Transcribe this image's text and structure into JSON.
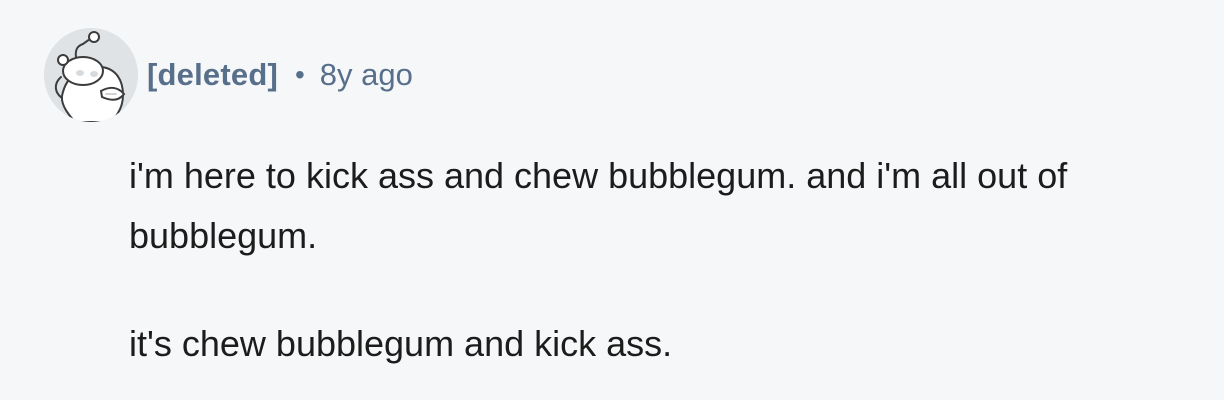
{
  "comment": {
    "avatar_icon": "deleted-user-snoo-icon",
    "author": "[deleted]",
    "separator": "•",
    "timestamp": "8y ago",
    "paragraphs": [
      "i'm here to kick ass and chew bubblegum. and i'm all out of bubblegum.",
      "it's chew bubblegum and kick ass."
    ]
  },
  "colors": {
    "background": "#f6f7f8",
    "author": "#576f8a",
    "text": "#1c1c1c"
  }
}
